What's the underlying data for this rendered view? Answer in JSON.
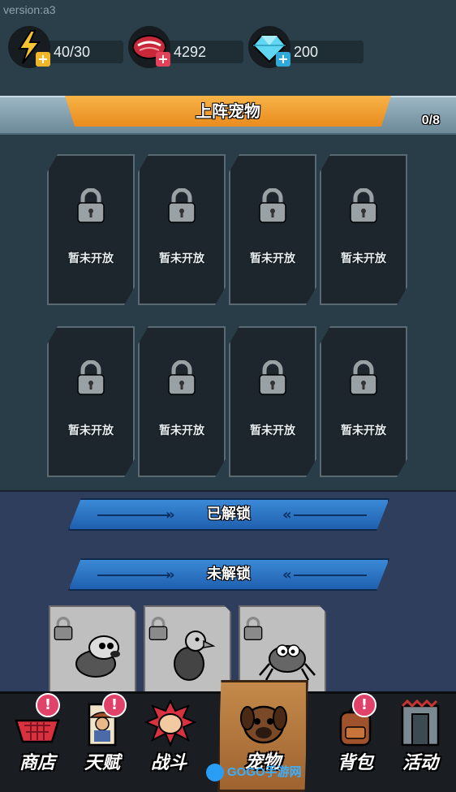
{
  "version": "version:a3",
  "resources": [
    {
      "icon": "energy-bolt-icon",
      "value": "40/30"
    },
    {
      "icon": "meat-icon",
      "value": "4292"
    },
    {
      "icon": "diamond-icon",
      "value": "200"
    }
  ],
  "deploy": {
    "title": "上阵宠物",
    "count": "0/8",
    "slots": [
      {
        "label": "暂未开放"
      },
      {
        "label": "暂未开放"
      },
      {
        "label": "暂未开放"
      },
      {
        "label": "暂未开放"
      },
      {
        "label": "暂未开放"
      },
      {
        "label": "暂未开放"
      },
      {
        "label": "暂未开放"
      },
      {
        "label": "暂未开放"
      }
    ]
  },
  "unlocked_banner": "已解锁",
  "locked_banner": "未解锁",
  "locked_pets": [
    {
      "icon": "dog-pet-icon"
    },
    {
      "icon": "vulture-pet-icon"
    },
    {
      "icon": "spider-pet-icon"
    }
  ],
  "nav": {
    "shop": "商店",
    "talent": "天赋",
    "battle": "战斗",
    "pet": "宠物",
    "bag": "背包",
    "activity": "活动",
    "badge": "!"
  },
  "watermark": "GOGO手游网",
  "colors": {
    "accent_orange": "#f0a032",
    "banner_blue": "#2a74c8",
    "badge_pink": "#e0426a"
  }
}
